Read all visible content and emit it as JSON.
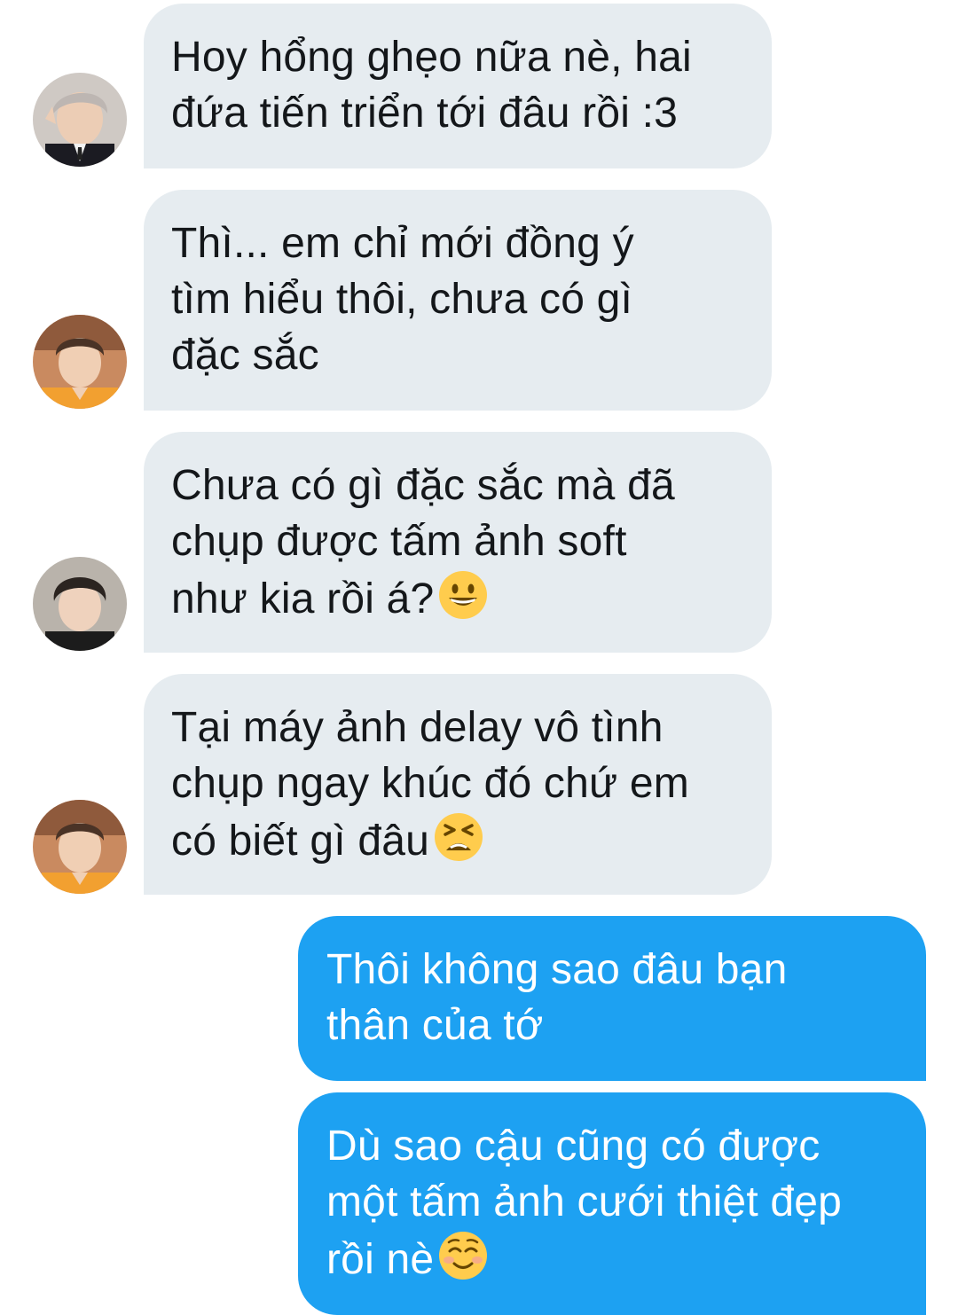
{
  "conversation": {
    "messages": [
      {
        "direction": "incoming",
        "avatar": "avatar-icon-gray-hair",
        "lines": [
          "Hoy hổng ghẹo nữa nè, hai",
          "đứa tiến triển tới đâu rồi :3"
        ]
      },
      {
        "direction": "incoming",
        "avatar": "avatar-icon-orange-shirt",
        "lines": [
          "Thì... em chỉ mới đồng ý",
          "tìm hiểu thôi, chưa có gì",
          "đặc sắc"
        ]
      },
      {
        "direction": "incoming",
        "avatar": "avatar-icon-dark-hair",
        "lines": [
          "Chưa có gì đặc sắc mà đã",
          "chụp được tấm ảnh soft",
          "như kia rồi á?"
        ],
        "emoji": "grinning-face-icon"
      },
      {
        "direction": "incoming",
        "avatar": "avatar-icon-orange-shirt",
        "lines": [
          "Tại máy ảnh delay vô tình",
          "chụp ngay khúc đó chứ em",
          "có biết gì đâu"
        ],
        "emoji": "tired-face-icon"
      },
      {
        "direction": "outgoing",
        "lines": [
          "Thôi không sao đâu bạn",
          "thân của tớ"
        ]
      },
      {
        "direction": "outgoing",
        "lines": [
          "Dù sao cậu cũng có được",
          "một tấm ảnh cưới thiệt đẹp",
          "rồi nè"
        ],
        "emoji": "smiling-face-icon"
      }
    ]
  },
  "colors": {
    "incoming_bubble": "#e6ecf0",
    "incoming_text": "#14171a",
    "outgoing_bubble": "#1da1f2",
    "outgoing_text": "#ffffff",
    "background": "#ffffff"
  }
}
